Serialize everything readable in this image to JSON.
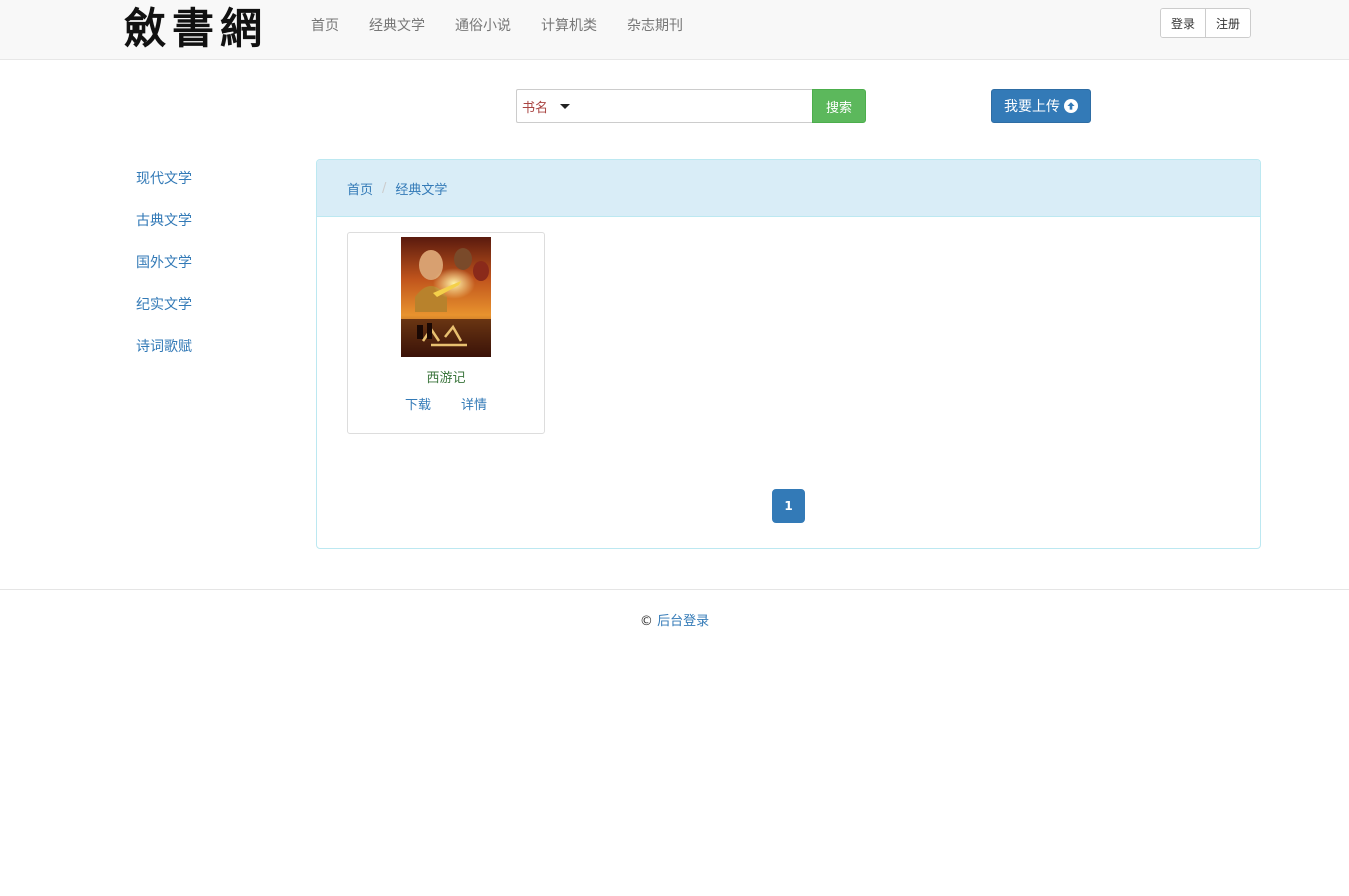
{
  "navbar": {
    "logo_text": "斂書網",
    "links": [
      {
        "label": "首页"
      },
      {
        "label": "经典文学"
      },
      {
        "label": "通俗小说"
      },
      {
        "label": "计算机类"
      },
      {
        "label": "杂志期刊"
      }
    ],
    "login_label": "登录",
    "register_label": "注册"
  },
  "search": {
    "type_label": "书名",
    "input_value": "",
    "button_label": "搜索"
  },
  "upload": {
    "label": "我要上传",
    "icon": "circle-arrow-up-icon"
  },
  "sidebar": {
    "items": [
      {
        "label": "现代文学"
      },
      {
        "label": "古典文学"
      },
      {
        "label": "国外文学"
      },
      {
        "label": "纪实文学"
      },
      {
        "label": "诗词歌赋"
      }
    ]
  },
  "breadcrumb": {
    "items": [
      "首页",
      "经典文学"
    ],
    "separator": "/"
  },
  "books": [
    {
      "title": "西游记",
      "download_label": "下载",
      "details_label": "详情"
    }
  ],
  "pagination": {
    "current_page": "1"
  },
  "footer": {
    "symbol": "©",
    "link_label": "后台登录"
  },
  "colors": {
    "primary": "#337ab7",
    "success": "#5cb85c",
    "panel_heading": "#d9edf7",
    "panel_border": "#bce8f1",
    "search_type_text": "#a94442",
    "book_title_text": "#3c763d"
  }
}
